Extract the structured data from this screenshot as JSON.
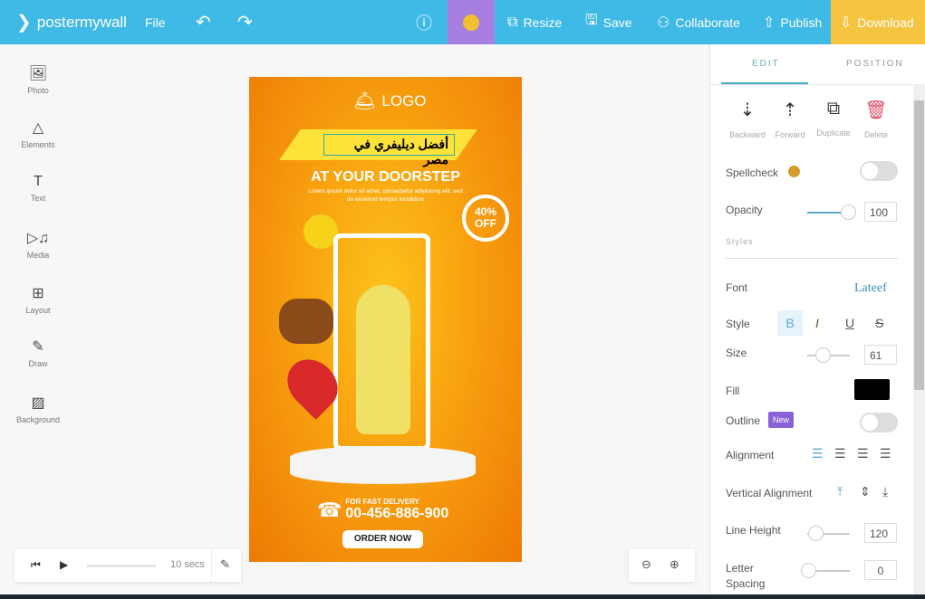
{
  "topbar": {
    "brand": "postermywall",
    "file": "File",
    "resize": "Resize",
    "save": "Save",
    "collaborate": "Collaborate",
    "publish": "Publish",
    "download": "Download",
    "colors": {
      "bar": "#3fb9e6",
      "premium": "#a67fe0",
      "download": "#f5c542"
    }
  },
  "sidebar": {
    "items": [
      {
        "label": "Photo",
        "icon": "image-icon"
      },
      {
        "label": "Elements",
        "icon": "shapes-icon"
      },
      {
        "label": "Text",
        "icon": "text-icon"
      },
      {
        "label": "Media",
        "icon": "media-icon"
      },
      {
        "label": "Layout",
        "icon": "layout-icon"
      },
      {
        "label": "Draw",
        "icon": "pencil-icon"
      },
      {
        "label": "Background",
        "icon": "background-icon"
      }
    ]
  },
  "poster": {
    "logo": "LOGO",
    "arabic": "أفضل ديليفري في مصر",
    "headline": "AT YOUR DOORSTEP",
    "body": "Lorem ipsum dolor sit amet, consectetur adipiscing elit, sed do eiusmod tempor incididunt",
    "discount": "40% OFF",
    "delivery_label": "FOR FAST DELIVERY",
    "phone": "00-456-886-900",
    "cta": "ORDER NOW"
  },
  "panel": {
    "tabs": [
      "EDIT",
      "POSITION"
    ],
    "actions": [
      "Backward",
      "Forward",
      "Duplicate",
      "Delete"
    ],
    "spellcheck": "Spellcheck",
    "opacity": "Opacity",
    "opacity_value": "100",
    "styles": "Styles",
    "font": "Font",
    "font_value": "Lateef",
    "style": "Style",
    "size": "Size",
    "size_value": "61",
    "fill": "Fill",
    "fill_color": "#000000",
    "outline": "Outline",
    "new_badge": "New",
    "alignment": "Alignment",
    "vertical_alignment": "Vertical Alignment",
    "line_height": "Line Height",
    "line_height_value": "120",
    "letter_spacing": "Letter Spacing",
    "letter_spacing_value": "0"
  },
  "playback": {
    "duration": "10",
    "unit": "secs"
  }
}
